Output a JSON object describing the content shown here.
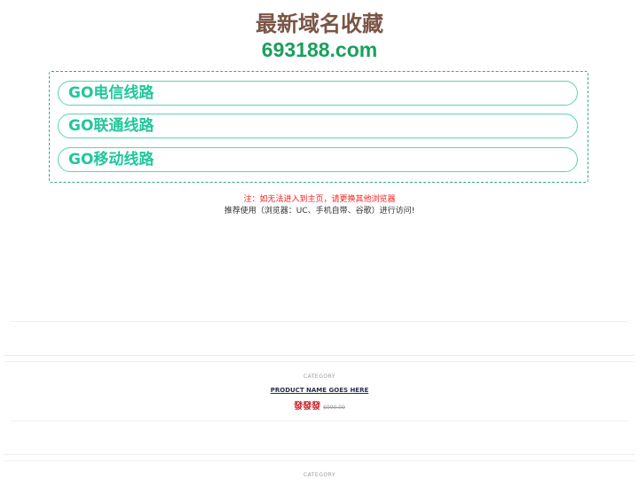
{
  "header": {
    "title": "最新域名收藏",
    "domain": "693188.com"
  },
  "routes": [
    {
      "label": "GO电信线路"
    },
    {
      "label": "GO联通线路"
    },
    {
      "label": "GO移动线路"
    }
  ],
  "notice": {
    "warning": "注：如无法进入到主页，请更换其他浏览器",
    "recommend": "推荐使用（浏览器：UC、手机自带、谷歌）进行访问!"
  },
  "products": [
    {
      "category": "CATEGORY",
      "name": "PRODUCT NAME GOES HERE",
      "price": "發發發",
      "old_price": "$990.00"
    },
    {
      "category": "CATEGORY"
    }
  ],
  "colors": {
    "title": "#7a5545",
    "domain": "#1aa05a",
    "route_text": "#20c79b",
    "route_border": "#58d3b8",
    "box_border": "#2fa98a",
    "warning": "#ff2020",
    "price": "#d0202a"
  }
}
